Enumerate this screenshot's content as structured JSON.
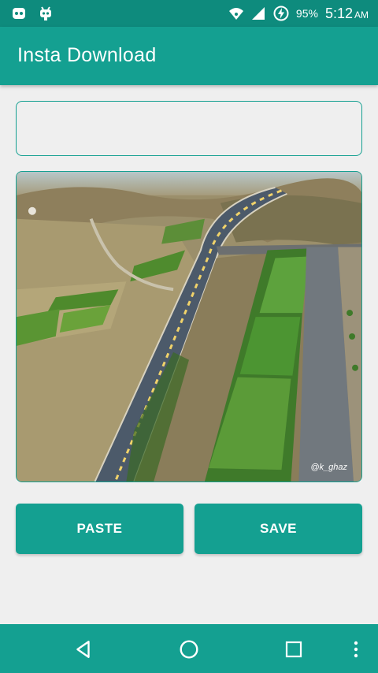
{
  "status_bar": {
    "battery_percent": "95%",
    "time": "5:12",
    "ampm": "AM",
    "icons": [
      "notification-icon",
      "android-debug-icon",
      "wifi-icon",
      "signal-icon",
      "battery-charging-icon"
    ]
  },
  "app_bar": {
    "title": "Insta Download"
  },
  "url_input": {
    "value": "",
    "placeholder": ""
  },
  "preview": {
    "watermark": "@k_ghaz",
    "alt": "aerial highway photo"
  },
  "buttons": {
    "paste_label": "PASTE",
    "save_label": "SAVE"
  },
  "nav_bar": {
    "icons": [
      "back-icon",
      "home-icon",
      "recents-icon",
      "overflow-menu-icon"
    ]
  },
  "colors": {
    "status_bar": "#0e8b7d",
    "accent": "#14a091",
    "background": "#efefef"
  }
}
